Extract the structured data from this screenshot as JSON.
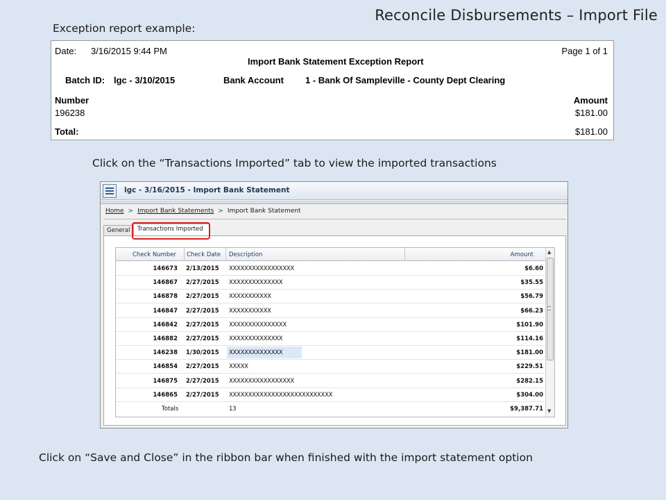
{
  "slide": {
    "title": "Reconcile Disbursements – Import File",
    "caption_exception": "Exception report example:",
    "caption_tab": "Click on the “Transactions Imported” tab to view the imported transactions",
    "caption_save": "Click on “Save and Close” in the ribbon bar when finished with the import statement option"
  },
  "report": {
    "date_label": "Date:",
    "date_value": "3/16/2015 9:44 PM",
    "page": "Page 1 of 1",
    "title": "Import Bank Statement Exception Report",
    "batch_label": "Batch ID:",
    "batch_value": "lgc - 3/10/2015",
    "account_label": "Bank Account",
    "account_value": "1 - Bank Of Sampleville - County Dept Clearing",
    "number_header": "Number",
    "amount_header": "Amount",
    "rows": [
      {
        "number": "196238",
        "amount": "$181.00"
      }
    ],
    "total_label": "Total:",
    "total_value": "$181.00"
  },
  "window": {
    "title": "lgc - 3/16/2015 - Import Bank Statement",
    "breadcrumb": [
      "Home",
      "Import Bank Statements",
      "Import Bank Statement"
    ],
    "tabs": [
      "General",
      "Transactions Imported"
    ]
  },
  "grid": {
    "columns": [
      "Check Number",
      "Check Date",
      "Description",
      "Amount"
    ],
    "rows": [
      {
        "num": "146673",
        "date": "2/13/2015",
        "desc": "XXXXXXXXXXXXXXXXX",
        "amt": "$6.60"
      },
      {
        "num": "146867",
        "date": "2/27/2015",
        "desc": "XXXXXXXXXXXXXX",
        "amt": "$35.55"
      },
      {
        "num": "146878",
        "date": "2/27/2015",
        "desc": "XXXXXXXXXXX",
        "amt": "$56.79"
      },
      {
        "num": "146847",
        "date": "2/27/2015",
        "desc": "XXXXXXXXXXX",
        "amt": "$66.23"
      },
      {
        "num": "146842",
        "date": "2/27/2015",
        "desc": "XXXXXXXXXXXXXXX",
        "amt": "$101.90"
      },
      {
        "num": "146882",
        "date": "2/27/2015",
        "desc": "XXXXXXXXXXXXXX",
        "amt": "$114.16"
      },
      {
        "num": "146238",
        "date": "1/30/2015",
        "desc": "XXXXXXXXXXXXXX",
        "amt": "$181.00"
      },
      {
        "num": "146854",
        "date": "2/27/2015",
        "desc": "XXXXX",
        "amt": "$229.51"
      },
      {
        "num": "146875",
        "date": "2/27/2015",
        "desc": "XXXXXXXXXXXXXXXXX",
        "amt": "$282.15"
      },
      {
        "num": "146865",
        "date": "2/27/2015",
        "desc": "XXXXXXXXXXXXXXXXXXXXXXXXXXX",
        "amt": "$304.00"
      }
    ],
    "selected_row": 6,
    "totals_label": "Totals",
    "totals_count": "13",
    "totals_amount": "$9,387.71"
  },
  "colors": {
    "background": "#dce6f2",
    "highlight": "#d9201f",
    "header_text": "#1f3a66"
  }
}
